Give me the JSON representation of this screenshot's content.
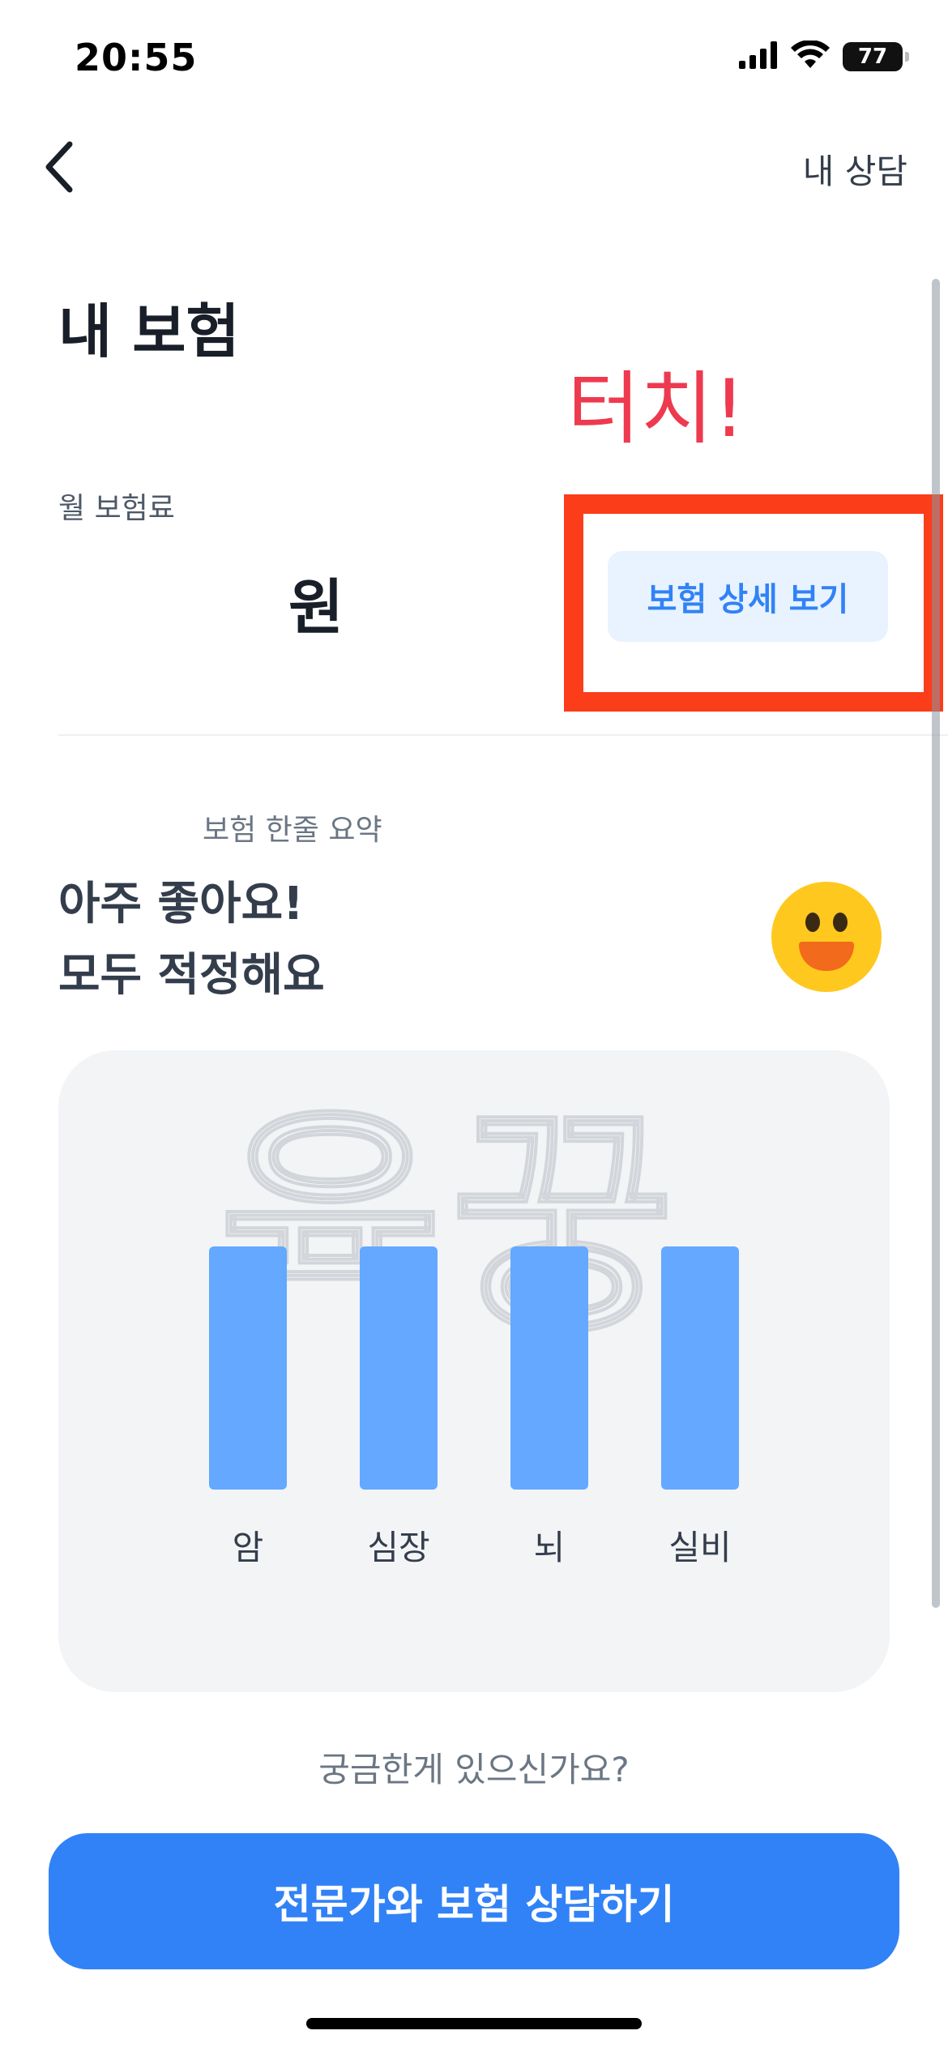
{
  "status_bar": {
    "time": "20:55",
    "battery": "77",
    "icons": [
      "cellular-signal-icon",
      "wifi-icon",
      "battery-icon"
    ]
  },
  "nav": {
    "back_icon": "chevron-left-icon",
    "right_label": "내 상담"
  },
  "page_title": "내 보험",
  "annotation": {
    "text": "터치!",
    "color": "#ee3a4f",
    "box_color": "#fb3d1a"
  },
  "premium": {
    "label": "월 보험료",
    "value": "원"
  },
  "detail_button": {
    "label": "보험 상세 보기"
  },
  "summary": {
    "label": "보험 한줄 요약",
    "line1": "아주 좋아요!",
    "line2": "모두 적정해요",
    "emoji_icon": "smiley-face-icon"
  },
  "watermark": "육꿍",
  "coverage_chart": {
    "bar_color": "#64a8ff",
    "items": [
      {
        "label": "암",
        "level": 1.0
      },
      {
        "label": "심장",
        "level": 1.0
      },
      {
        "label": "뇌",
        "level": 1.0
      },
      {
        "label": "실비",
        "level": 1.0
      }
    ]
  },
  "question": "궁금한게 있으신가요?",
  "cta": {
    "label": "전문가와 보험 상담하기",
    "color": "#3182f6"
  }
}
